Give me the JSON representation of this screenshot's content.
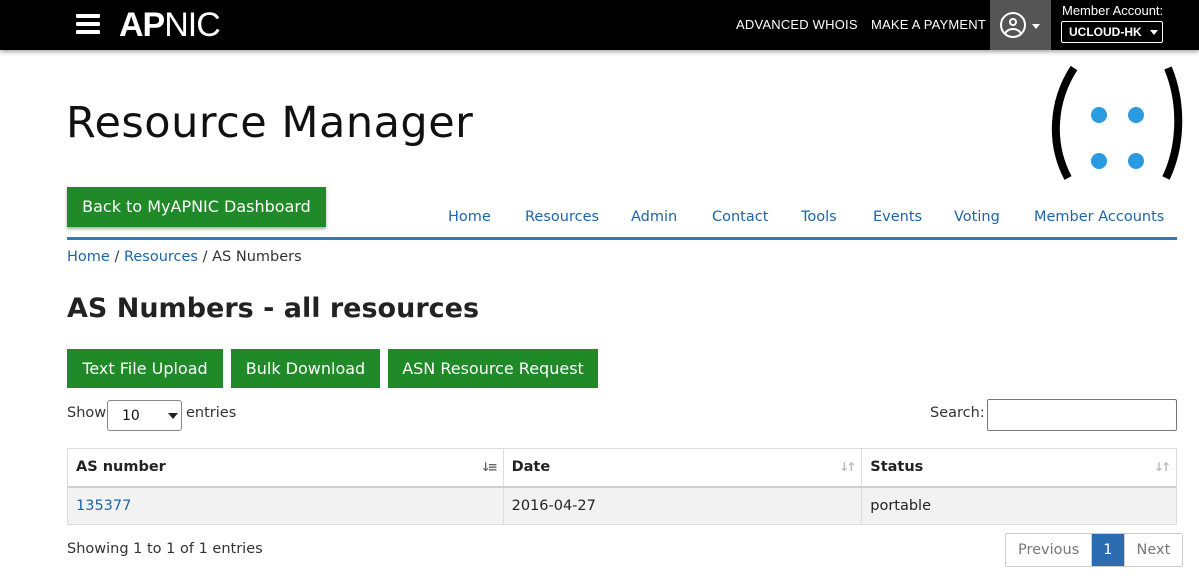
{
  "topbar": {
    "logo_bold": "AP",
    "logo_light": "NIC",
    "links": [
      "ADVANCED WHOIS",
      "MAKE A PAYMENT"
    ],
    "member_label": "Member Account:",
    "member_value": "UCLOUD-HK"
  },
  "header": {
    "title": "Resource Manager",
    "dashboard_button": "Back to MyAPNIC Dashboard"
  },
  "nav": {
    "items": [
      "Home",
      "Resources",
      "Admin",
      "Contact",
      "Tools",
      "Events",
      "Voting",
      "Member Accounts"
    ]
  },
  "breadcrumb": {
    "items": [
      "Home",
      "Resources"
    ],
    "separator": "/",
    "current": "AS Numbers"
  },
  "main": {
    "title": "AS Numbers - all resources",
    "actions": [
      "Text File Upload",
      "Bulk Download",
      "ASN Resource Request"
    ],
    "show_label": "Show",
    "page_length": "10",
    "entries_label": "entries",
    "search_label": "Search:",
    "search_value": ""
  },
  "table": {
    "columns": [
      "AS number",
      "Date",
      "Status"
    ],
    "rows": [
      [
        "135377",
        "2016-04-27",
        "portable"
      ]
    ]
  },
  "footer": {
    "info": "Showing 1 to 1 of 1 entries",
    "previous": "Previous",
    "current_page": "1",
    "next": "Next"
  },
  "colors": {
    "topbar": "#000000",
    "accent_green": "#1f8a27",
    "link_blue": "#1f64a8",
    "nav_rule": "#2b7bbf",
    "logo_dots": "#2a9be0"
  }
}
